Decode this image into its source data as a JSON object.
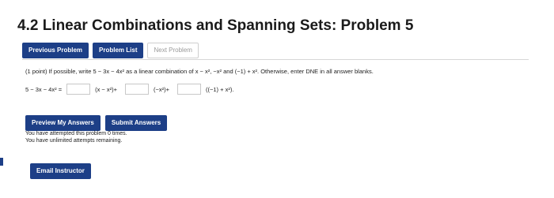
{
  "header": {
    "title": "4.2 Linear Combinations and Spanning Sets: Problem 5"
  },
  "nav": {
    "previous": "Previous Problem",
    "list": "Problem List",
    "next": "Next Problem"
  },
  "problem": {
    "text": "(1 point) If possible, write 5 − 3x − 4x² as a linear combination of x − x², −x² and (−1) + x². Otherwise, enter DNE in all answer blanks.",
    "lhs": "5 − 3x − 4x² =",
    "term1": "(x − x²)+",
    "term2": "(−x²)+",
    "term3": "((−1) + x²)."
  },
  "actions": {
    "preview": "Preview My Answers",
    "submit": "Submit Answers"
  },
  "status": {
    "attempted": "You have attempted this problem 0 times.",
    "remaining": "You have unlimited attempts remaining."
  },
  "footer": {
    "email": "Email Instructor"
  }
}
